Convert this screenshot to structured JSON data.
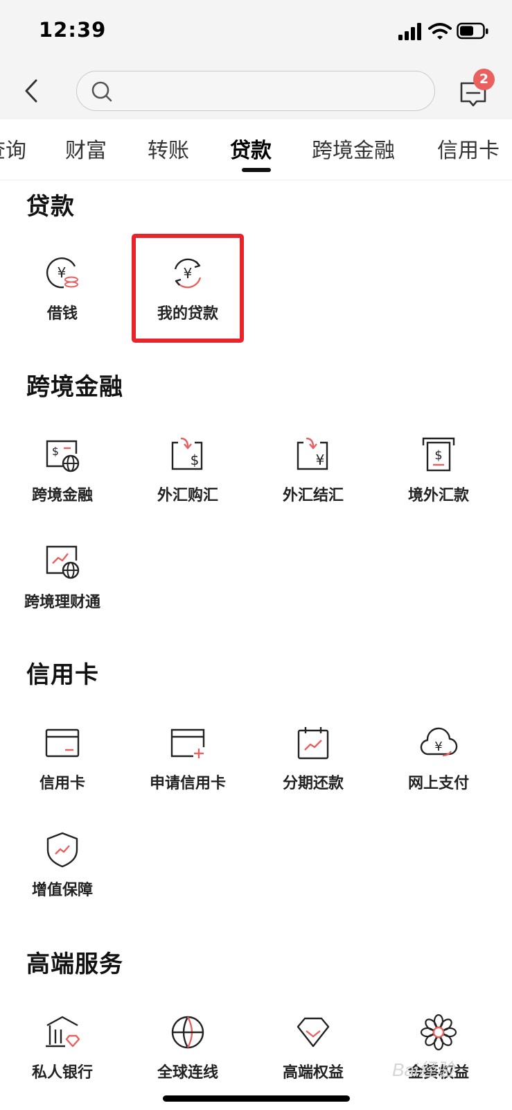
{
  "status_bar": {
    "time": "12:39"
  },
  "header": {
    "search_placeholder": "",
    "message_badge": "2"
  },
  "tabs": [
    {
      "label": "查询"
    },
    {
      "label": "财富"
    },
    {
      "label": "转账"
    },
    {
      "label": "贷款"
    },
    {
      "label": "跨境金融"
    },
    {
      "label": "信用卡"
    }
  ],
  "active_tab": "贷款",
  "sections": {
    "loan": {
      "title": "贷款",
      "items": [
        {
          "label": "借钱",
          "icon": "yen-coins-icon"
        },
        {
          "label": "我的贷款",
          "icon": "yen-cycle-icon"
        }
      ]
    },
    "crossborder": {
      "title": "跨境金融",
      "items": [
        {
          "label": "跨境金融",
          "icon": "dollar-globe-icon"
        },
        {
          "label": "外汇购汇",
          "icon": "dollar-exchange-icon"
        },
        {
          "label": "外汇结汇",
          "icon": "yen-exchange-icon"
        },
        {
          "label": "境外汇款",
          "icon": "atm-dollar-icon"
        },
        {
          "label": "跨境理财通",
          "icon": "chart-globe-icon"
        }
      ]
    },
    "creditcard": {
      "title": "信用卡",
      "items": [
        {
          "label": "信用卡",
          "icon": "credit-card-icon"
        },
        {
          "label": "申请信用卡",
          "icon": "card-add-icon"
        },
        {
          "label": "分期还款",
          "icon": "calendar-chart-icon"
        },
        {
          "label": "网上支付",
          "icon": "cloud-yen-icon"
        },
        {
          "label": "增值保障",
          "icon": "shield-chart-icon"
        }
      ]
    },
    "premium": {
      "title": "高端服务",
      "items": [
        {
          "label": "私人银行",
          "icon": "bank-gem-icon"
        },
        {
          "label": "全球连线",
          "icon": "globe-icon"
        },
        {
          "label": "高端权益",
          "icon": "diamond-icon"
        },
        {
          "label": "金葵权益",
          "icon": "flower-icon"
        }
      ]
    }
  },
  "watermark": "Bai经验",
  "colors": {
    "accent": "#e9605f",
    "highlight": "#e8242a",
    "text": "#222222",
    "header_bg": "#f4f4f4"
  }
}
